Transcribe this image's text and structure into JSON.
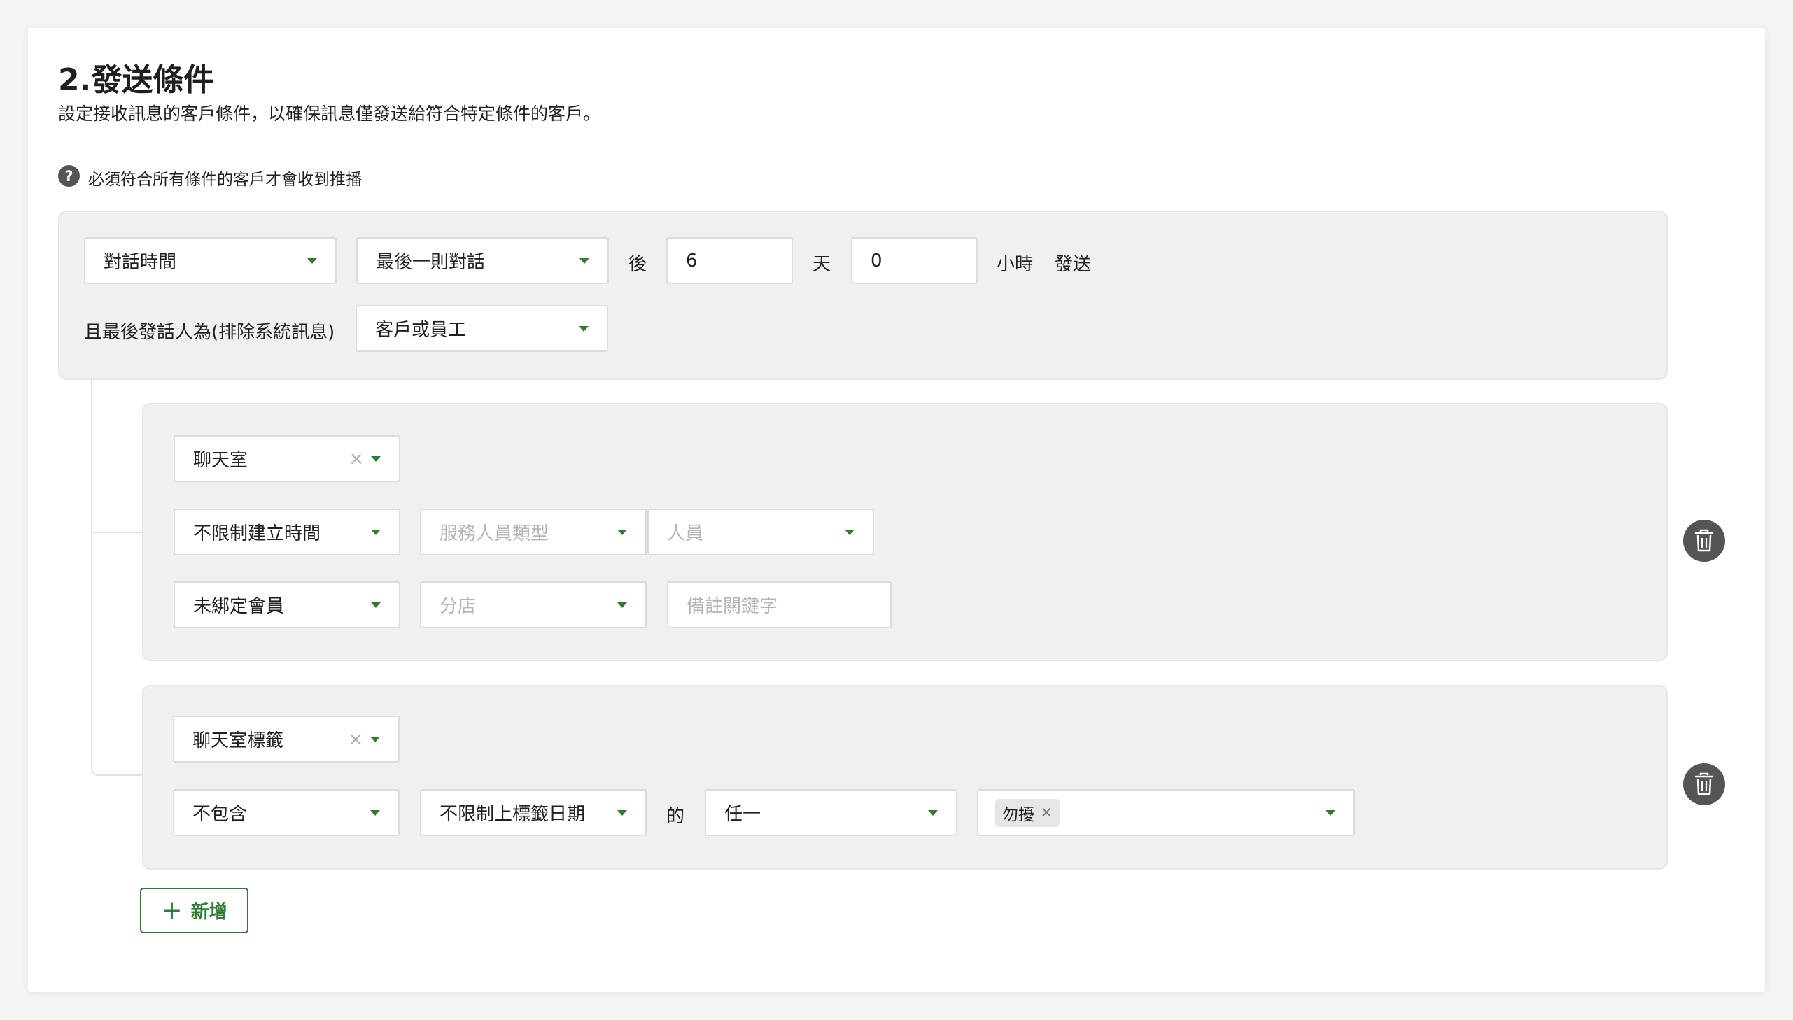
{
  "section": {
    "title": "2.發送條件",
    "subtitle": "設定接收訊息的客戶條件，以確保訊息僅發送給符合特定條件的客戶。",
    "note": "必須符合所有條件的客戶才會收到推播",
    "help_icon": "question-circle-icon"
  },
  "primary_condition": {
    "type_select": "對話時間",
    "reference_select": "最後一則對話",
    "after_label": "後",
    "days_value": "6",
    "days_unit": "天",
    "hours_value": "0",
    "hours_unit": "小時",
    "send_label": "發送",
    "last_sender_label": "且最後發話人為(排除系統訊息)",
    "last_sender_select": "客戶或員工"
  },
  "condition_groups": [
    {
      "type_select": "聊天室",
      "time_select": "不限制建立時間",
      "staff_type_placeholder": "服務人員類型",
      "staff_placeholder": "人員",
      "member_select": "未綁定會員",
      "branch_placeholder": "分店",
      "keyword_placeholder": "備註關鍵字"
    },
    {
      "type_select": "聊天室標籤",
      "include_select": "不包含",
      "date_select": "不限制上標籤日期",
      "of_label": "的",
      "any_select": "任一",
      "tags": [
        "勿擾"
      ]
    }
  ],
  "add_button": {
    "label": "新增"
  },
  "colors": {
    "accent": "#2e7d32",
    "panel": "#f0f0f0",
    "icon_dark": "#555555"
  }
}
